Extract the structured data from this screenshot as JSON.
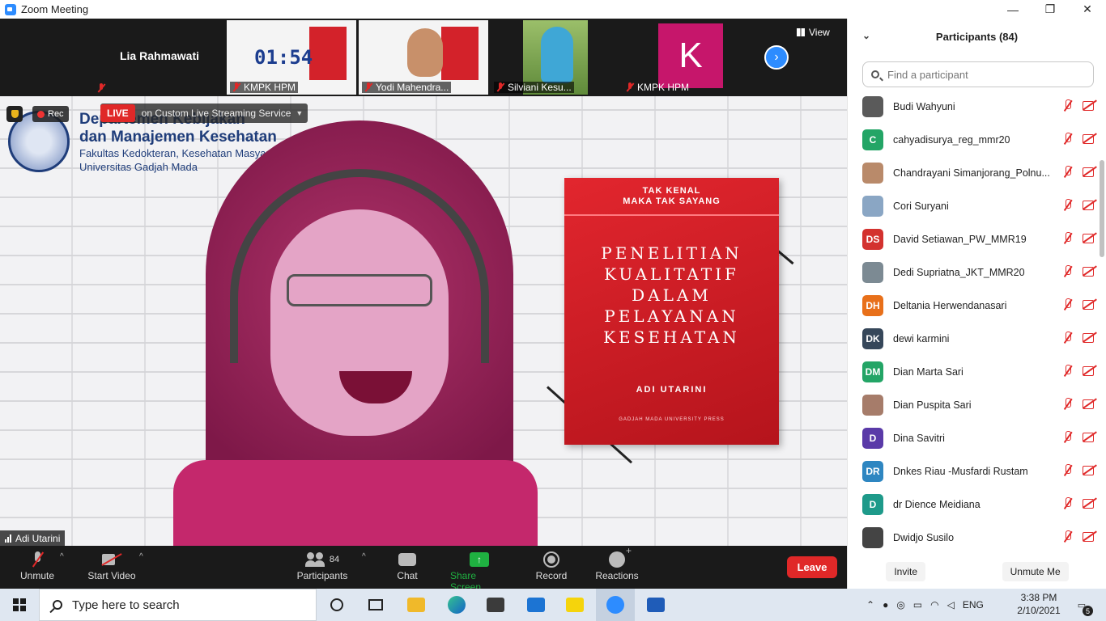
{
  "window": {
    "title": "Zoom Meeting",
    "controls": {
      "minimize": "—",
      "maximize": "❐",
      "close": "✕"
    }
  },
  "thumbnails": {
    "tiles": [
      {
        "name": "Lia Rahmawati",
        "label": "",
        "muted": true
      },
      {
        "name": "KMPK HPM",
        "timer": "01:54",
        "muted": true
      },
      {
        "name": "Yodi Mahendra...",
        "muted": true
      },
      {
        "name": "Silviani Kesu...",
        "muted": true
      },
      {
        "name": "KMPK HPM",
        "avatar_letter": "K",
        "avatar_color": "#C6166B",
        "muted": true
      }
    ],
    "next_icon": "›",
    "view_label": "View"
  },
  "main_video": {
    "recording_label": "Rec",
    "live_badge": "LIVE",
    "streaming_service": "on Custom Live Streaming Service",
    "background_text": {
      "line1": "Departemen Kebijakan",
      "line2": "dan Manajemen Kesehatan",
      "line3": "Fakultas Kedokteran, Kesehatan Masyarakat",
      "line4": "Universitas Gadjah Mada"
    },
    "book": {
      "subtitle_line1": "TAK KENAL",
      "subtitle_line2": "MAKA TAK SAYANG",
      "title_lines": [
        "PENELITIAN",
        "KUALITATIF",
        "DALAM",
        "PELAYANAN",
        "KESEHATAN"
      ],
      "author": "ADI UTARINI",
      "publisher": "GADJAH MADA UNIVERSITY PRESS"
    },
    "active_speaker": "Adi Utarini"
  },
  "toolbar": {
    "unmute": "Unmute",
    "start_video": "Start Video",
    "participants": "Participants",
    "participant_count": "84",
    "chat": "Chat",
    "share_screen": "Share Screen",
    "record": "Record",
    "reactions": "Reactions",
    "leave": "Leave",
    "caret": "^",
    "share_icon": "↑"
  },
  "participants_panel": {
    "title": "Participants (84)",
    "collapse_icon": "⌄",
    "search_placeholder": "Find a participant",
    "invite": "Invite",
    "unmute_me": "Unmute Me",
    "participants": [
      {
        "name": "Budi Wahyuni",
        "initials": "",
        "color": "#5a5a5a"
      },
      {
        "name": "cahyadisurya_reg_mmr20",
        "initials": "C",
        "color": "#23A566"
      },
      {
        "name": "Chandrayani Simanjorang_Polnu...",
        "initials": "",
        "color": "#b98a6a"
      },
      {
        "name": "Cori Suryani",
        "initials": "",
        "color": "#8aa6c4"
      },
      {
        "name": "David Setiawan_PW_MMR19",
        "initials": "DS",
        "color": "#D3322F"
      },
      {
        "name": "Dedi Supriatna_JKT_MMR20",
        "initials": "",
        "color": "#7c8a93"
      },
      {
        "name": "Deltania Herwendanasari",
        "initials": "DH",
        "color": "#E8701A"
      },
      {
        "name": "dewi karmini",
        "initials": "DK",
        "color": "#36475A"
      },
      {
        "name": "Dian Marta Sari",
        "initials": "DM",
        "color": "#23A566"
      },
      {
        "name": "Dian Puspita Sari",
        "initials": "",
        "color": "#a67c6a"
      },
      {
        "name": "Dina Savitri",
        "initials": "D",
        "color": "#5A3AA8"
      },
      {
        "name": "Dnkes Riau -Musfardi Rustam",
        "initials": "DR",
        "color": "#2E86C1"
      },
      {
        "name": "dr Dience Meidiana",
        "initials": "D",
        "color": "#1E9A8A"
      },
      {
        "name": "Dwidjo Susilo",
        "initials": "",
        "color": "#444444"
      }
    ]
  },
  "taskbar": {
    "search_placeholder": "Type here to search",
    "language": "ENG",
    "time": "3:38 PM",
    "date": "2/10/2021",
    "notification_count": "5"
  }
}
